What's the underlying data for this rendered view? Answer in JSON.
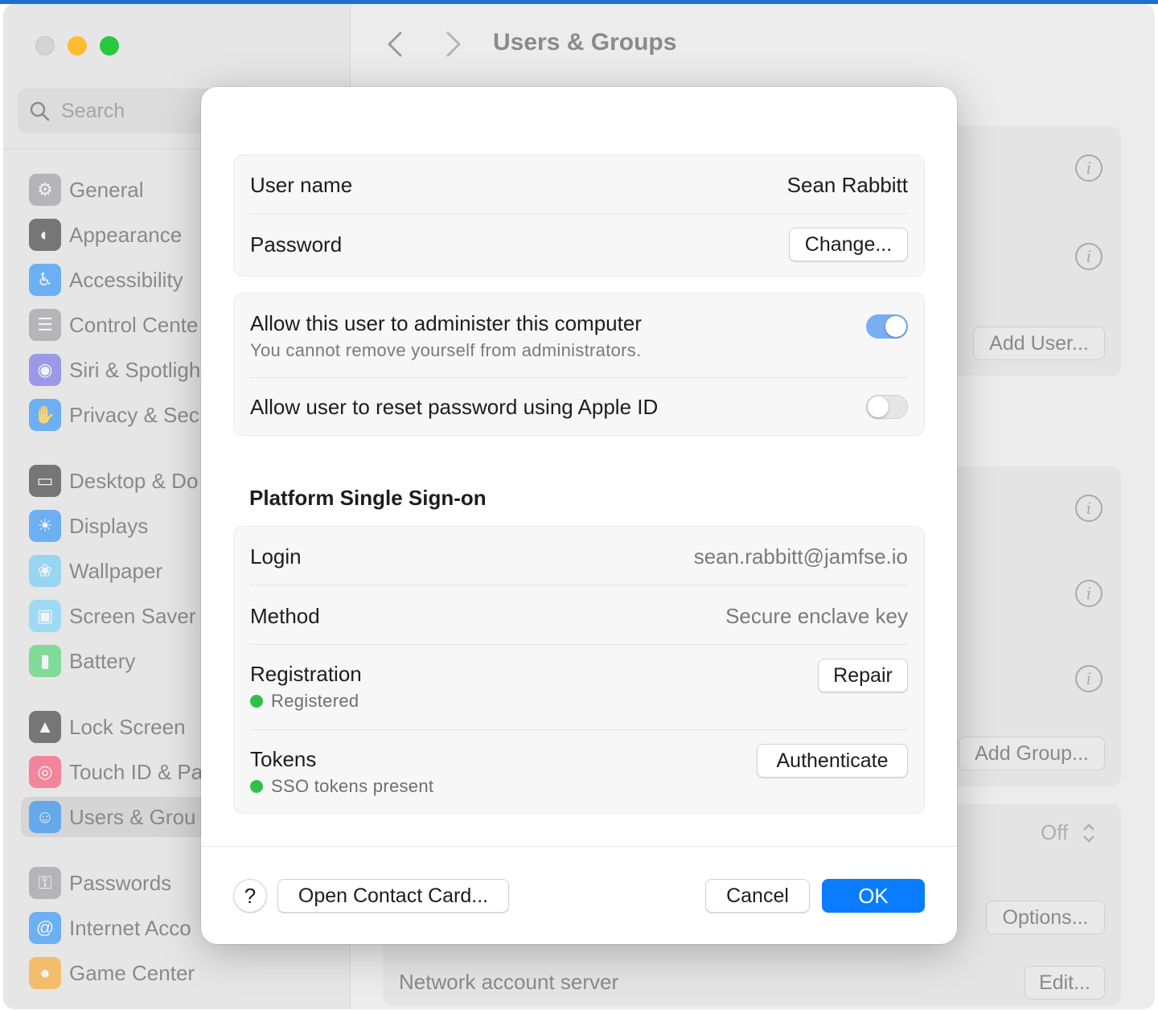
{
  "window": {
    "title": "Users & Groups"
  },
  "search": {
    "placeholder": "Search"
  },
  "sidebar": {
    "items": [
      {
        "label": "General",
        "icon": "gear-icon",
        "color": "#8e8e93"
      },
      {
        "label": "Appearance",
        "icon": "appearance-icon",
        "color": "#1c1c1e"
      },
      {
        "label": "Accessibility",
        "icon": "accessibility-icon",
        "color": "#0a84ff"
      },
      {
        "label": "Control Cente",
        "icon": "control-center-icon",
        "color": "#8e8e93"
      },
      {
        "label": "Siri & Spotligh",
        "icon": "siri-icon",
        "color": "#5e5ce6"
      },
      {
        "label": "Privacy & Sec",
        "icon": "hand-icon",
        "color": "#0a84ff"
      },
      {
        "label": "Desktop & Do",
        "icon": "desktop-icon",
        "color": "#1c1c1e"
      },
      {
        "label": "Displays",
        "icon": "sun-icon",
        "color": "#0a84ff"
      },
      {
        "label": "Wallpaper",
        "icon": "flower-icon",
        "color": "#5ac8fa"
      },
      {
        "label": "Screen Saver",
        "icon": "screen-saver-icon",
        "color": "#64d2ff"
      },
      {
        "label": "Battery",
        "icon": "battery-icon",
        "color": "#30d158"
      },
      {
        "label": "Lock Screen",
        "icon": "lock-icon",
        "color": "#1c1c1e"
      },
      {
        "label": "Touch ID & Pa",
        "icon": "fingerprint-icon",
        "color": "#ff375f"
      },
      {
        "label": "Users & Grou",
        "icon": "users-icon",
        "color": "#0a84ff"
      },
      {
        "label": "Passwords",
        "icon": "key-icon",
        "color": "#8e8e93"
      },
      {
        "label": "Internet Acco",
        "icon": "at-icon",
        "color": "#0a84ff"
      },
      {
        "label": "Game Center",
        "icon": "game-center-icon",
        "color": "#ff9f0a"
      }
    ]
  },
  "background": {
    "add_user_label": "Add User...",
    "add_group_label": "Add Group...",
    "off_label": "Off",
    "options_label": "Options...",
    "network_account_label": "Network account server",
    "edit_label": "Edit..."
  },
  "dialog": {
    "account": {
      "username_label": "User name",
      "username_value": "Sean Rabbitt",
      "password_label": "Password",
      "change_label": "Change..."
    },
    "admin": {
      "label": "Allow this user to administer this computer",
      "sublabel": "You cannot remove yourself from administrators.",
      "enabled": true
    },
    "reset": {
      "label": "Allow user to reset password using Apple ID",
      "enabled": false
    },
    "psso": {
      "title": "Platform Single Sign-on",
      "login_label": "Login",
      "login_value": "sean.rabbitt@jamfse.io",
      "method_label": "Method",
      "method_value": "Secure enclave key",
      "registration_label": "Registration",
      "registration_status": "Registered",
      "repair_label": "Repair",
      "tokens_label": "Tokens",
      "tokens_status": "SSO tokens present",
      "authenticate_label": "Authenticate",
      "status_color": "#30c04a"
    },
    "footer": {
      "help_label": "?",
      "open_contact_label": "Open Contact Card...",
      "cancel_label": "Cancel",
      "ok_label": "OK"
    }
  }
}
